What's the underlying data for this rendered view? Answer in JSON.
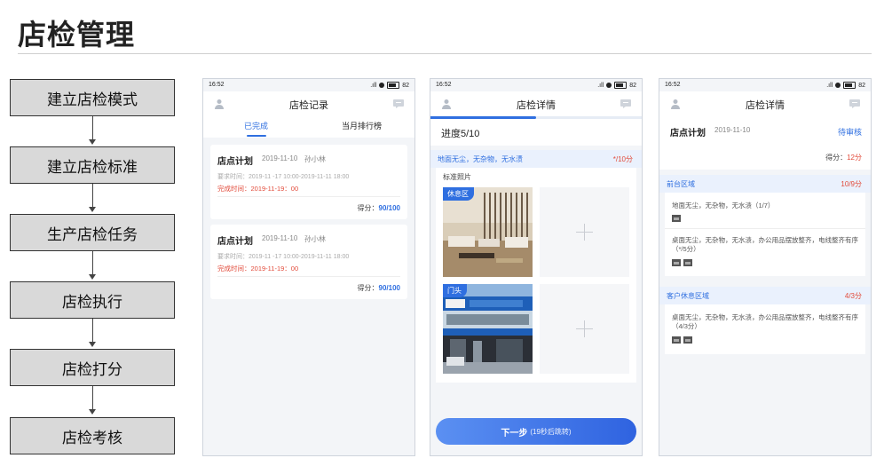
{
  "page_title": "店检管理",
  "flow": [
    "建立店检模式",
    "建立店检标准",
    "生产店检任务",
    "店检执行",
    "店检打分",
    "店检考核"
  ],
  "status_bar": {
    "time": "16:52",
    "signal": ".ıll",
    "battery": "82"
  },
  "colors": {
    "accent": "#2f6fe0",
    "alert": "#e24b3b",
    "flow_box": "#d9d9d9"
  },
  "records": {
    "title": "店检记录",
    "tabs": [
      {
        "label": "已完成",
        "active": true
      },
      {
        "label": "当月排行榜",
        "active": false
      }
    ],
    "cards": [
      {
        "name": "店点计划",
        "date": "2019-11-10",
        "person": "孙小林",
        "required": "要求时间：2019-11 -17 10:00-2019-11-11 18:00",
        "completed": "完成时间：2019-11-19：00",
        "score_label": "得分：",
        "score": "90/100"
      },
      {
        "name": "店点计划",
        "date": "2019-11-10",
        "person": "孙小林",
        "required": "要求时间：2019-11 -17 10:00-2019-11-11 18:00",
        "completed": "完成时间：2019-11-19：00",
        "score_label": "得分：",
        "score": "90/100"
      }
    ]
  },
  "detail": {
    "title": "店检详情",
    "progress_text": "进度5/10",
    "progress_fraction": 0.5,
    "item": "地面无尘，无杂物，无水渍",
    "item_points": "*/10分",
    "photo_label": "标准照片",
    "photos": [
      {
        "tag": "休息区"
      },
      {
        "tag": "门头"
      }
    ],
    "next_button": "下一步",
    "next_hint": "(19秒后跳转)"
  },
  "review": {
    "title": "店检详情",
    "plan_name": "店点计划",
    "plan_date": "2019-11-10",
    "status": "待审核",
    "score_label": "得分：",
    "score": "12分",
    "areas": [
      {
        "name": "前台区域",
        "points": "10/9分",
        "items": [
          "地面无尘，无杂物，无水渍（1/7）",
          "桌面无尘，无杂物，无水渍，办公用品摆放整齐，电线整齐有序（*/5分）"
        ]
      },
      {
        "name": "客户休息区域",
        "points": "4/3分",
        "items": [
          "桌面无尘，无杂物，无水渍，办公用品摆放整齐，电线整齐有序（4/3分）"
        ]
      }
    ]
  }
}
